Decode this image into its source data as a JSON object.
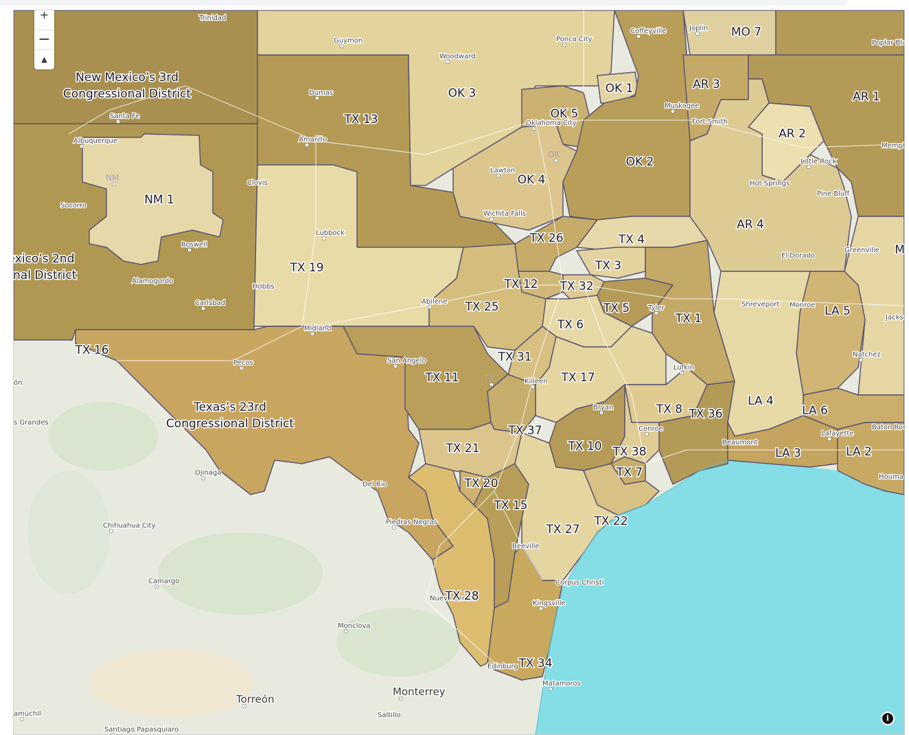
{
  "controls": {
    "zoom_in": "+",
    "zoom_out": "−",
    "compass": "▲",
    "info": "i"
  },
  "district_labels": [
    "New Mexico’s 3rd",
    "Congressional District",
    "exico’s 2nd",
    "onal District",
    "Texas’s 23rd",
    "Congressional District",
    "NM 1",
    "TX 13",
    "TX 19",
    "TX 16",
    "TX 11",
    "TX 25",
    "TX 12",
    "TX 26",
    "TX 4",
    "TX 3",
    "TX 32",
    "TX 5",
    "TX 1",
    "TX 6",
    "TX 31",
    "TX 17",
    "TX 8",
    "TX 36",
    "TX 37",
    "TX 10",
    "TX 38",
    "TX 7",
    "TX 21",
    "TX 20",
    "TX 15",
    "TX 22",
    "TX 27",
    "TX 28",
    "TX 34",
    "OK 1",
    "OK 2",
    "OK 3",
    "OK 4",
    "OK 5",
    "AR 1",
    "AR 2",
    "AR 3",
    "AR 4",
    "MO 7",
    "LA 2",
    "LA 3",
    "LA 4",
    "LA 5",
    "LA 6",
    "MS"
  ],
  "cities": [
    "Trinidad",
    "Guymon",
    "Ponca City",
    "Coffeyville",
    "Joplin",
    "Poplar Bluff",
    "Woodward",
    "Dumas",
    "Amarillo",
    "Oklahoma City",
    "Muskogee",
    "Fort Smith",
    "Santa Fe",
    "Albuquerque",
    "Clovis",
    "Lawton",
    "Little Rock",
    "Hot Springs",
    "Pine Bluff",
    "Memphis",
    "Socorro",
    "Wichita Falls",
    "Lubbock",
    "Roswell",
    "El Dorado",
    "Greenville",
    "Alamogordo",
    "Hobbs",
    "Carlsbad",
    "Abilene",
    "Tyler",
    "Shreveport",
    "Monroe",
    "Jackson",
    "Midland",
    "Pecos",
    "San Angelo",
    "Natchez",
    "Killeen",
    "Lufkin",
    "Bryan",
    "Conroe",
    "Beaumont",
    "Baton Rouge",
    "Lafayette",
    "Houma",
    "Del Rio",
    "Ojinaga",
    "Piedras Negras",
    "Chihuahua City",
    "Beeville",
    "Corpus Christi",
    "Camargo",
    "Nuevo Laredo",
    "Kingsville",
    "Monclova",
    "Edinburg",
    "Matamoros",
    "Monterrey",
    "Torreón",
    "Saltillo",
    "Santiago Papasquiaro",
    "amúchil",
    "s Grandes",
    "ón",
    "NM",
    "OK",
    "TX",
    "New"
  ],
  "colors": {
    "water": "#85dde6",
    "land": "#e6e9df",
    "district_boundary": "#5c5570",
    "label_halo": "#ffffff"
  }
}
